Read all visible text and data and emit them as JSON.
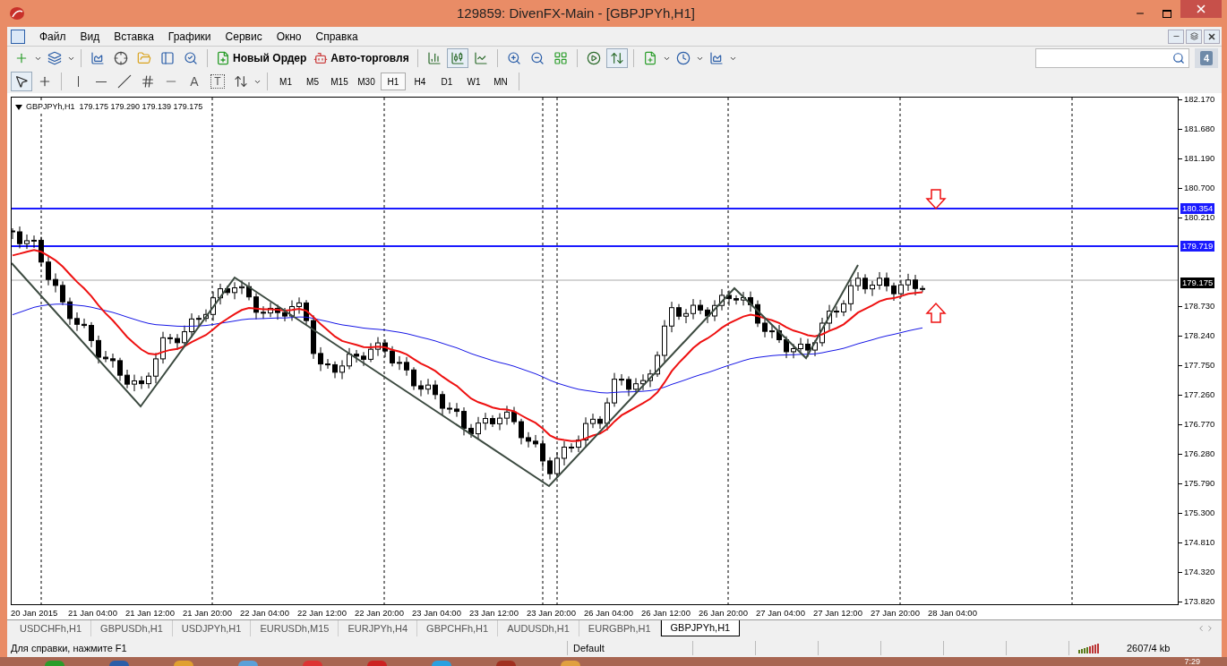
{
  "window": {
    "title": "129859: DivenFX-Main - [GBPJPYh,H1]"
  },
  "menu": [
    "Файл",
    "Вид",
    "Вставка",
    "Графики",
    "Сервис",
    "Окно",
    "Справка"
  ],
  "toolbar": {
    "order_button": "Новый Ордер",
    "autotrade_button": "Авто-торговля",
    "notification_count": "4",
    "text_tool": "A",
    "label_tool": "T"
  },
  "timeframes": [
    {
      "label": "M1",
      "selected": false
    },
    {
      "label": "M5",
      "selected": false
    },
    {
      "label": "M15",
      "selected": false
    },
    {
      "label": "M30",
      "selected": false
    },
    {
      "label": "H1",
      "selected": true
    },
    {
      "label": "H4",
      "selected": false
    },
    {
      "label": "D1",
      "selected": false
    },
    {
      "label": "W1",
      "selected": false
    },
    {
      "label": "MN",
      "selected": false
    }
  ],
  "chart": {
    "legend": "GBPJPYh,H1  179.175 179.290 179.139 179.175",
    "price_ticks": [
      "182.170",
      "181.680",
      "181.190",
      "180.700",
      "180.210",
      "178.730",
      "178.240",
      "177.750",
      "177.260",
      "176.770",
      "176.280",
      "175.790",
      "175.300",
      "174.810",
      "174.320",
      "173.820"
    ],
    "price_tags": [
      {
        "text": "180.354",
        "kind": "line"
      },
      {
        "text": "179.719",
        "kind": "line"
      },
      {
        "text": "179.175",
        "kind": "bid"
      }
    ],
    "time_labels": [
      "20 Jan 2015",
      "21 Jan 04:00",
      "21 Jan 12:00",
      "21 Jan 20:00",
      "22 Jan 04:00",
      "22 Jan 12:00",
      "22 Jan 20:00",
      "23 Jan 04:00",
      "23 Jan 12:00",
      "23 Jan 20:00",
      "26 Jan 04:00",
      "26 Jan 12:00",
      "26 Jan 20:00",
      "27 Jan 04:00",
      "27 Jan 12:00",
      "27 Jan 20:00",
      "28 Jan 04:00"
    ]
  },
  "tabs": [
    {
      "label": "USDCHFh,H1",
      "selected": false
    },
    {
      "label": "GBPUSDh,H1",
      "selected": false
    },
    {
      "label": "USDJPYh,H1",
      "selected": false
    },
    {
      "label": "EURUSDh,M15",
      "selected": false
    },
    {
      "label": "EURJPYh,H4",
      "selected": false
    },
    {
      "label": "GBPCHFh,H1",
      "selected": false
    },
    {
      "label": "AUDUSDh,H1",
      "selected": false
    },
    {
      "label": "EURGBPh,H1",
      "selected": false
    },
    {
      "label": "GBPJPYh,H1",
      "selected": true
    }
  ],
  "status_bar": {
    "help": "Для справки, нажмите F1",
    "profile": "Default",
    "traffic": "2607/4 kb"
  },
  "taskbar": {
    "clock": "7:29"
  }
}
